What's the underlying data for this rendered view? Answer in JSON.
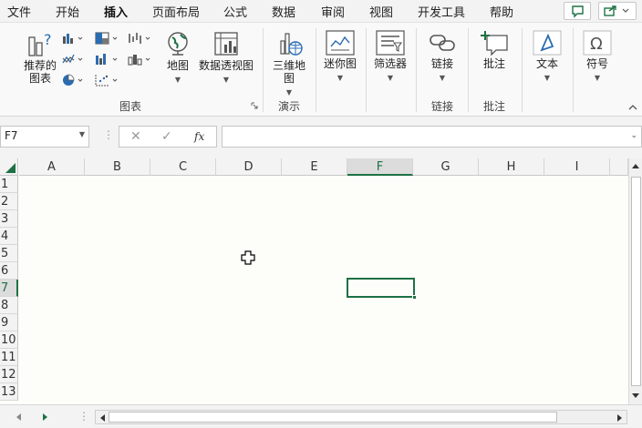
{
  "menu": {
    "tabs": [
      "文件",
      "开始",
      "插入",
      "页面布局",
      "公式",
      "数据",
      "审阅",
      "视图",
      "开发工具",
      "帮助"
    ],
    "active_tab": "插入"
  },
  "ribbon": {
    "recommended_charts": "推荐的\n图表",
    "maps": "地图",
    "pivot_chart": "数据透视图",
    "3d_map": "三维地\n图",
    "sparklines": "迷你图",
    "slicers": "筛选器",
    "link": "链接",
    "comment": "批注",
    "text": "文本",
    "symbols": "符号",
    "groups": {
      "charts": "图表",
      "tours": "演示",
      "links": "链接",
      "comments": "批注"
    }
  },
  "formula_bar": {
    "name_box": "F7",
    "cancel": "✕",
    "enter": "✓",
    "fx": "fx",
    "content": ""
  },
  "grid": {
    "columns": [
      "A",
      "B",
      "C",
      "D",
      "E",
      "F",
      "G",
      "H",
      "I"
    ],
    "rows": [
      "1",
      "2",
      "3",
      "4",
      "5",
      "6",
      "7",
      "8",
      "9",
      "10",
      "11",
      "12",
      "13"
    ],
    "selected_column": "F",
    "selected_row": "7"
  },
  "colors": {
    "accent": "#1e7145"
  }
}
